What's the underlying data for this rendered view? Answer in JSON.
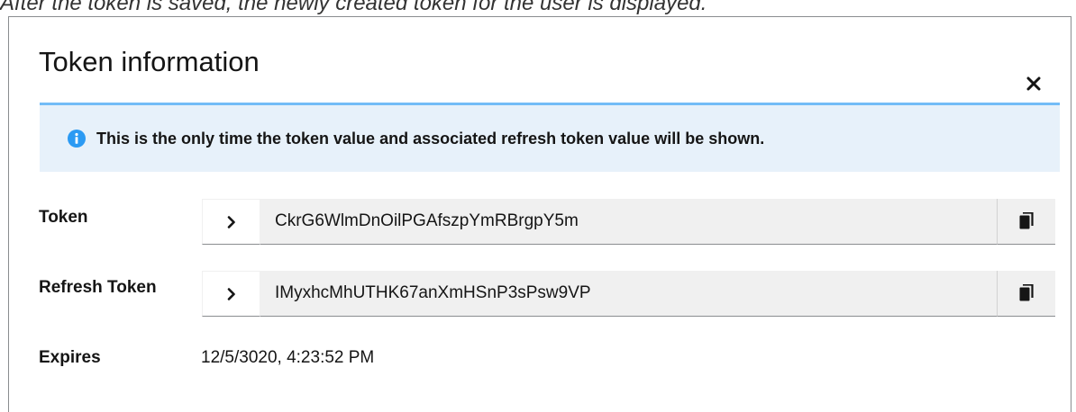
{
  "caption": "After the token is saved, the newly created token for the user is displayed.",
  "modal": {
    "title": "Token information",
    "close_icon": "close-icon"
  },
  "alert": {
    "icon": "info-circle-icon",
    "text": "This is the only time the token value and associated refresh token value will be shown.",
    "color": "#2b9af3",
    "background": "#e7f1fa"
  },
  "fields": {
    "token": {
      "label": "Token",
      "value": "CkrG6WlmDnOilPGAfszpYmRBrgpY5m",
      "toggle_icon": "chevron-right-icon",
      "copy_icon": "copy-icon"
    },
    "refresh_token": {
      "label": "Refresh Token",
      "value": "IMyxhcMhUTHK67anXmHSnP3sPsw9VP",
      "toggle_icon": "chevron-right-icon",
      "copy_icon": "copy-icon"
    },
    "expires": {
      "label": "Expires",
      "value": "12/5/3020, 4:23:52 PM"
    }
  }
}
